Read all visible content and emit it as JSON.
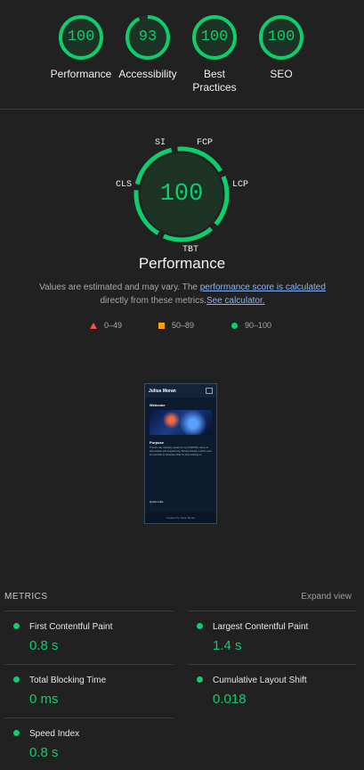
{
  "categories": [
    {
      "score": "100",
      "label": "Performance"
    },
    {
      "score": "93",
      "label": "Accessibility"
    },
    {
      "score": "100",
      "label": "Best Practices"
    },
    {
      "score": "100",
      "label": "SEO"
    }
  ],
  "performance_gauge": {
    "score": "100",
    "title": "Performance",
    "metric_labels": {
      "si": "SI",
      "fcp": "FCP",
      "cls": "CLS",
      "lcp": "LCP",
      "tbt": "TBT"
    }
  },
  "note": {
    "prefix": "Values are estimated and may vary. The ",
    "link_text": "performance score is calculated",
    "middle": "directly from these metrics.",
    "calculator_link": "See calculator."
  },
  "legend": {
    "fail": "0–49",
    "average": "50–89",
    "pass": "90–100"
  },
  "screenshot": {
    "site_name": "Julius Moran",
    "welcome": "Welcome",
    "purpose": "Purpose",
    "purpose_text": "This site was originally created for my CSS/HTML course to demonstrate web programming. Moving forward, it will be used as a portfolio to showcase what I've been working on.",
    "quick_links": "Quick Links",
    "footer": "Created by Julius Moran"
  },
  "metrics": {
    "title": "METRICS",
    "expand_label": "Expand view",
    "items": [
      {
        "name": "First Contentful Paint",
        "value": "0.8 s"
      },
      {
        "name": "Largest Contentful Paint",
        "value": "1.4 s"
      },
      {
        "name": "Total Blocking Time",
        "value": "0 ms"
      },
      {
        "name": "Cumulative Layout Shift",
        "value": "0.018"
      },
      {
        "name": "Speed Index",
        "value": "0.8 s"
      }
    ]
  },
  "colors": {
    "pass": "#0cce6b",
    "average": "#ffa400",
    "fail": "#ff4e42",
    "link": "#8ab4f8"
  }
}
